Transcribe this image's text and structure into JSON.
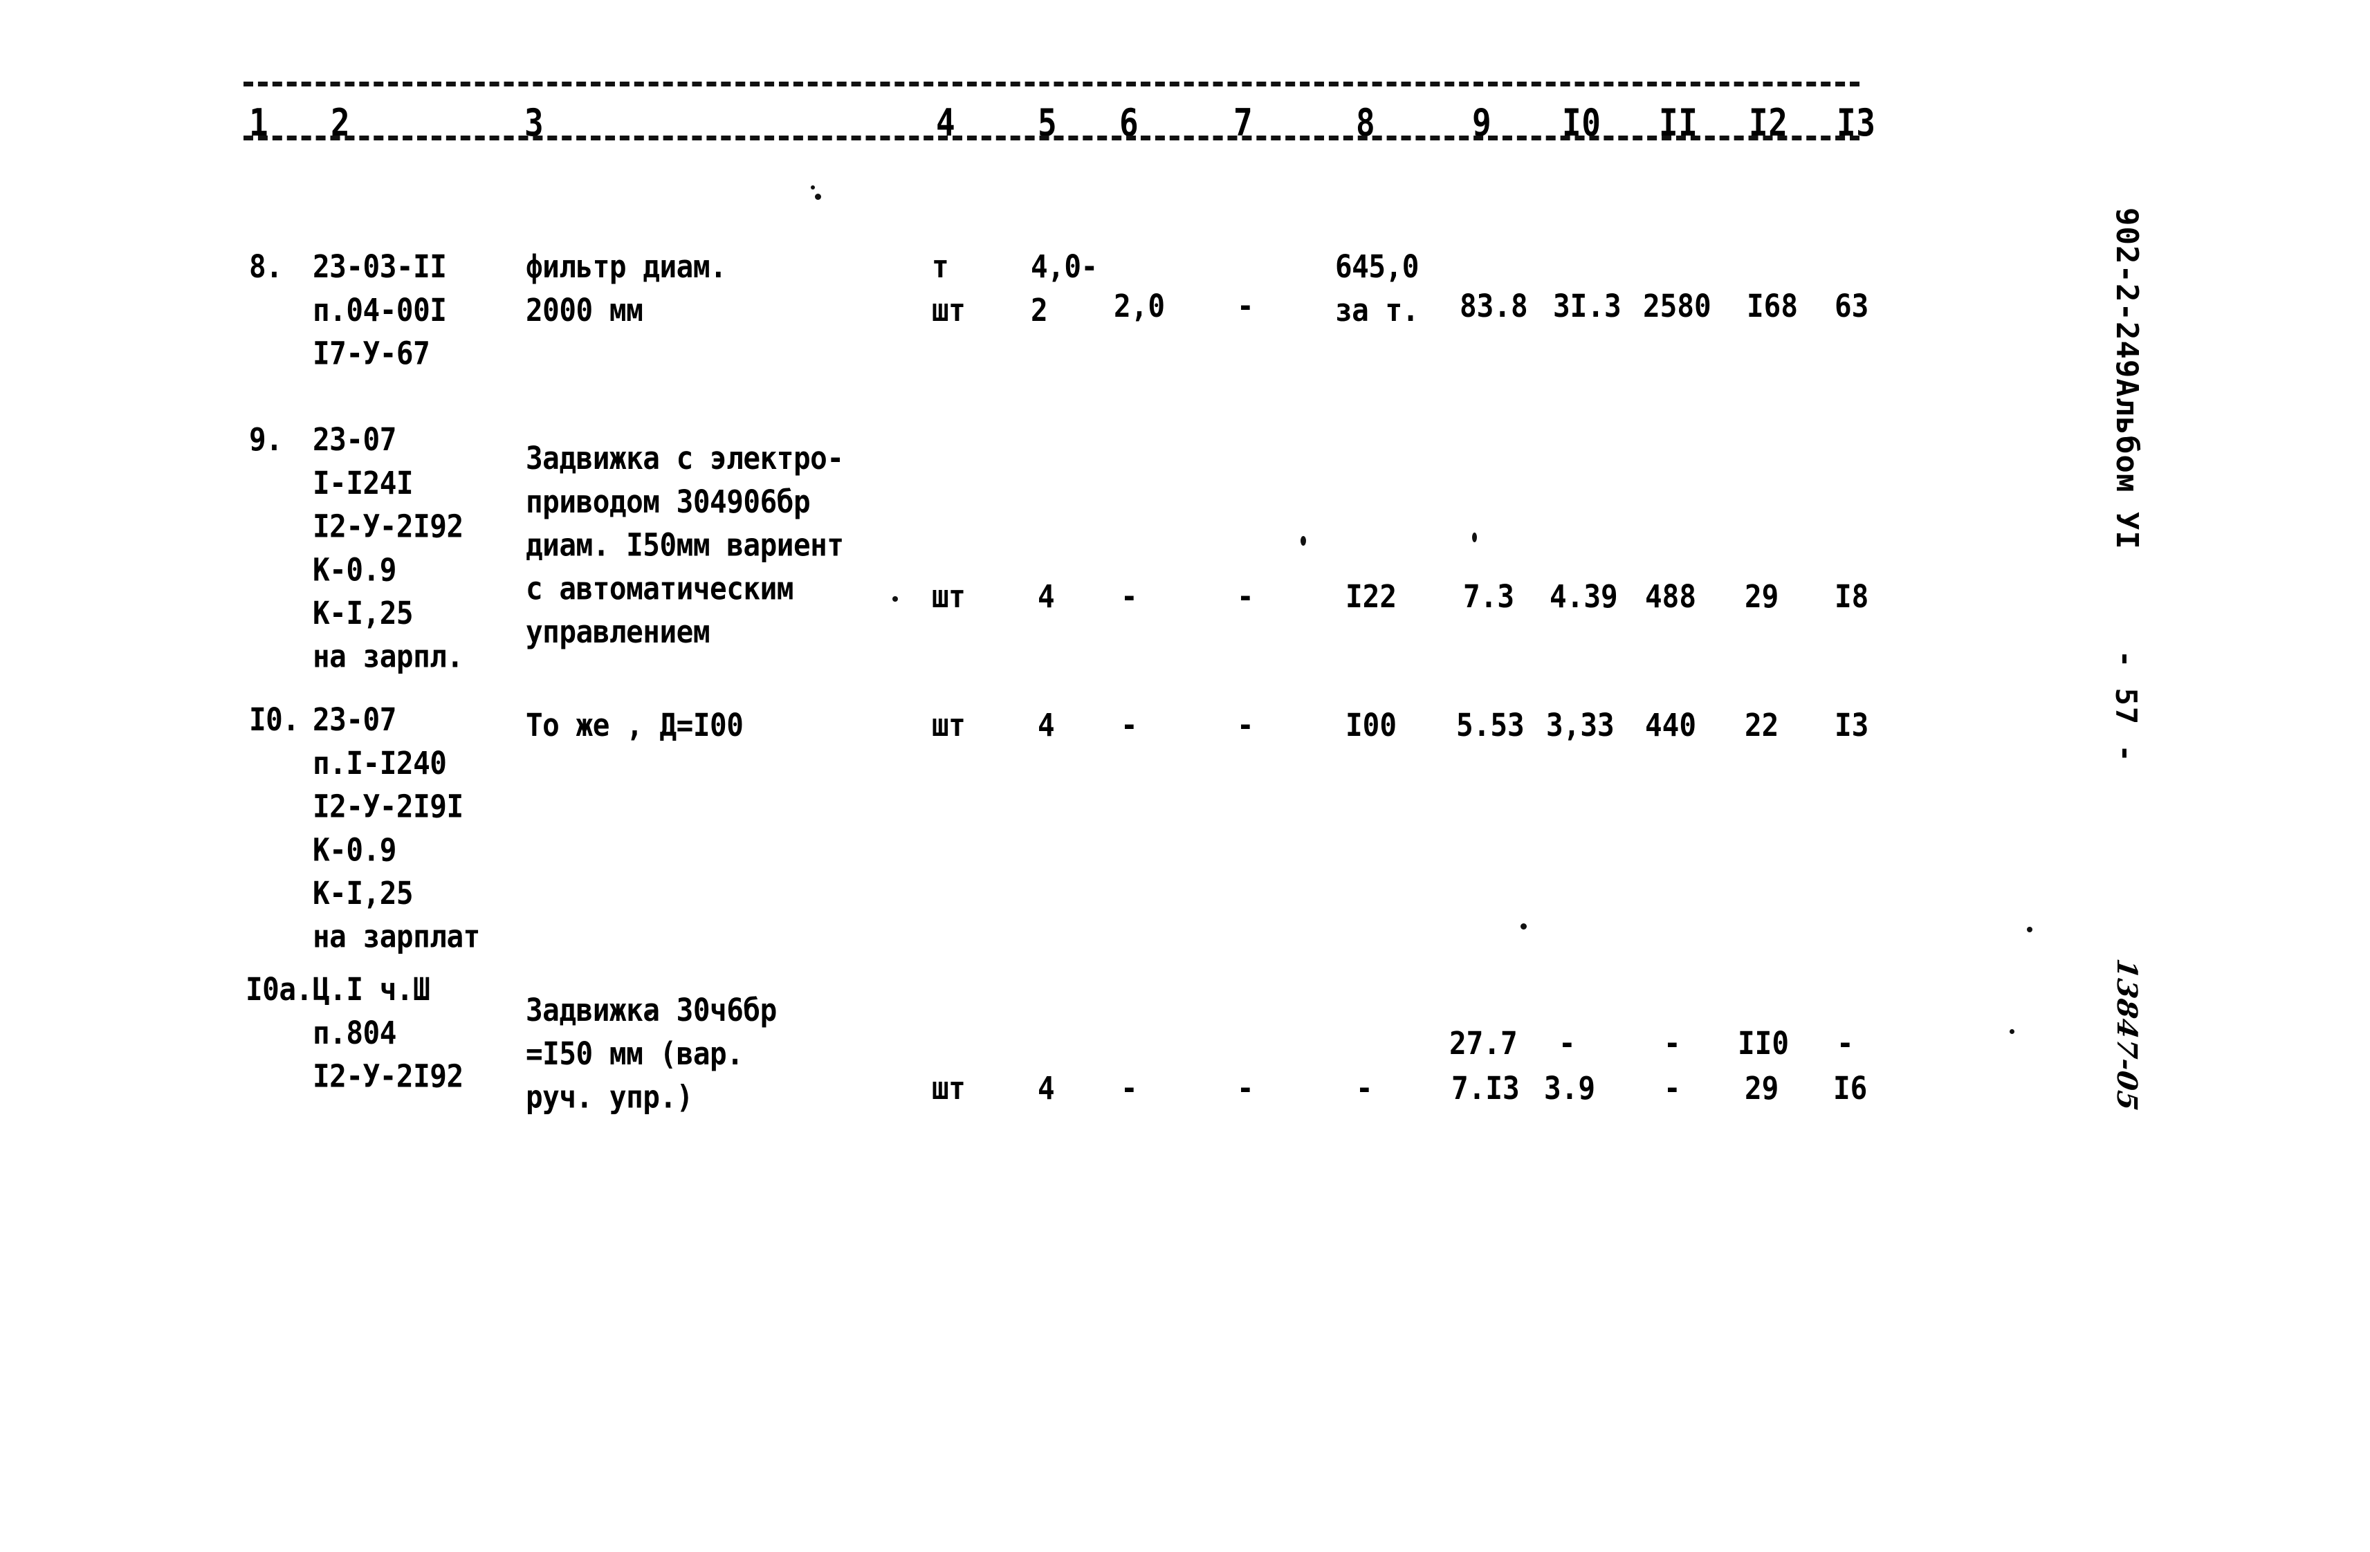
{
  "document": {
    "type": "scanned-estimate-table",
    "language": "ru",
    "margin_code": "902-2-249Альбом УI",
    "page_marker": "- 57 -",
    "handwritten_archive_number": "13847-05"
  },
  "table": {
    "column_headers": [
      "1",
      "2",
      "3",
      "4",
      "5",
      "6",
      "7",
      "8",
      "9",
      "I0",
      "II",
      "I2",
      "I3"
    ],
    "rows": [
      {
        "number": "8.",
        "code_lines": [
          "23-03-II",
          "п.04-00I",
          "I7-У-67"
        ],
        "description_lines": [
          "фильтр диам.",
          "2000 мм"
        ],
        "unit_lines": [
          "т",
          "шт"
        ],
        "col5_lines": [
          "4,0-",
          "2"
        ],
        "col6": "2,0",
        "col7": "-",
        "col8_lines": [
          "645,0",
          "за т."
        ],
        "col9": "83.8",
        "col10": "3I.3",
        "col11": "2580",
        "col12": "I68",
        "col13": "63"
      },
      {
        "number": "9.",
        "code_lines": [
          "23-07",
          "I-I24I",
          "I2-У-2I92",
          "К-0.9",
          "К-I,25",
          "на зарпл."
        ],
        "description_lines": [
          "Задвижка с электро-",
          "приводом 304906бр",
          "диам. I50мм вариент",
          "с автоматическим",
          "управлением"
        ],
        "unit": "шт",
        "col5": "4",
        "col6": "-",
        "col7": "-",
        "col8": "I22",
        "col9": "7.3",
        "col10": "4.39",
        "col11": "488",
        "col12": "29",
        "col13": "I8"
      },
      {
        "number": "I0.",
        "code_lines": [
          "23-07",
          "п.I-I240",
          "I2-У-2I9I",
          "К-0.9",
          "К-I,25",
          "на зарплат"
        ],
        "description_lines": [
          "То же , Д=I00"
        ],
        "unit": "шт",
        "col5": "4",
        "col6": "-",
        "col7": "-",
        "col8": "I00",
        "col9": "5.53",
        "col10": "3,33",
        "col11": "440",
        "col12": "22",
        "col13": "I3"
      },
      {
        "number": "I0a.",
        "code_lines": [
          "Ц.I ч.Ш",
          "п.804",
          "I2-У-2I92"
        ],
        "description_lines": [
          "Задвижка 30ч6бр",
          "=I50 мм (вар.",
          "руч. упр.)"
        ],
        "unit": "шт",
        "col5": "4",
        "col6": "-",
        "col7": "-",
        "col8": "-",
        "col9_top": "27.7",
        "col9_bottom": "7.I3",
        "col10_top": "-",
        "col10_bottom": "3.9",
        "col11_top": "-",
        "col11_bottom": "-",
        "col12_top": "II0",
        "col12_bottom": "29",
        "col13_top": "-",
        "col13_bottom": "I6"
      }
    ]
  }
}
